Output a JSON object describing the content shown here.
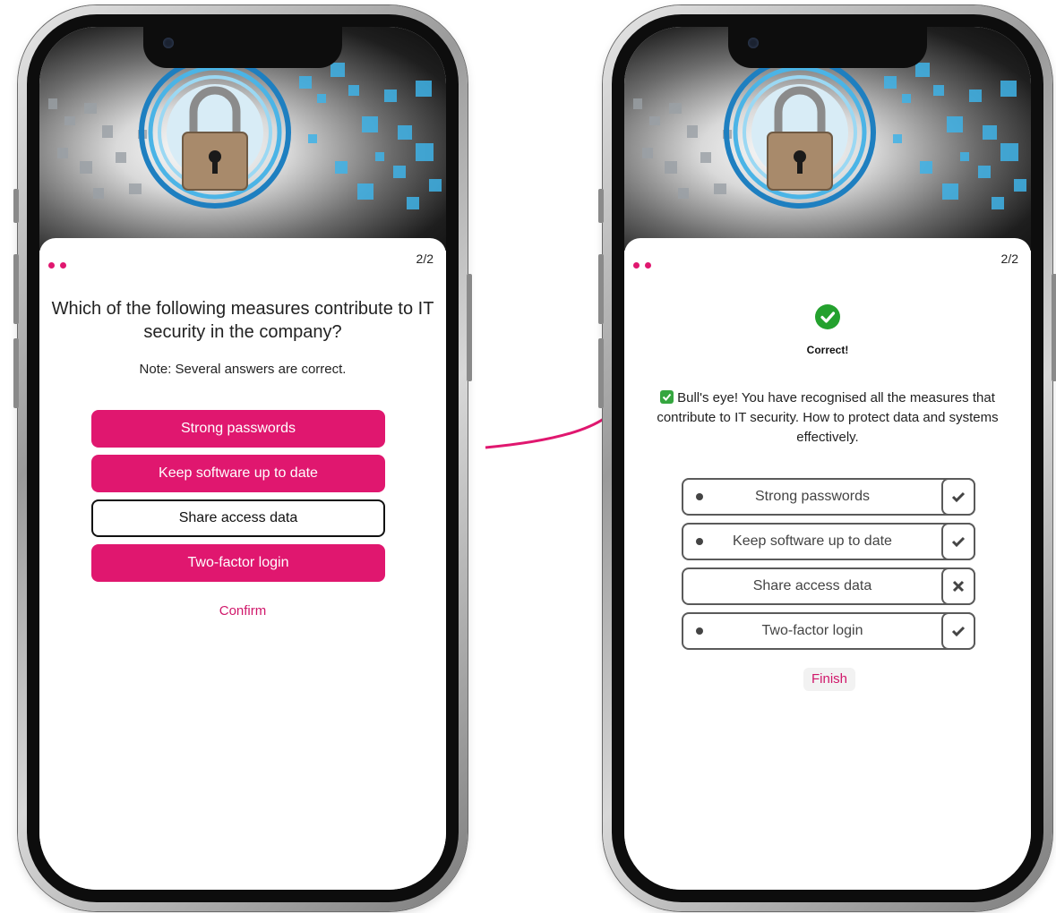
{
  "colors": {
    "accent": "#e0176f",
    "success": "#24a12e",
    "text": "#222222"
  },
  "question_screen": {
    "counter": "2/2",
    "question": "Which of the following measures contribute to IT security in the company?",
    "note": "Note: Several answers are correct.",
    "options": [
      {
        "label": "Strong passwords",
        "selected": true
      },
      {
        "label": "Keep software up to date",
        "selected": true
      },
      {
        "label": "Share access data",
        "selected": false
      },
      {
        "label": "Two-factor login",
        "selected": true
      }
    ],
    "confirm_label": "Confirm"
  },
  "result_screen": {
    "counter": "2/2",
    "status_icon": "check-circle-icon",
    "status_title": "Correct!",
    "feedback_text": "Bull's eye! You have recognised all the measures that contribute to IT security. How to protect data and systems effectively.",
    "results": [
      {
        "label": "Strong passwords",
        "chosen": true,
        "mark": "check-icon"
      },
      {
        "label": "Keep software up to date",
        "chosen": true,
        "mark": "check-icon"
      },
      {
        "label": "Share access data",
        "chosen": false,
        "mark": "cross-icon"
      },
      {
        "label": "Two-factor login",
        "chosen": true,
        "mark": "check-icon"
      }
    ],
    "finish_label": "Finish"
  }
}
